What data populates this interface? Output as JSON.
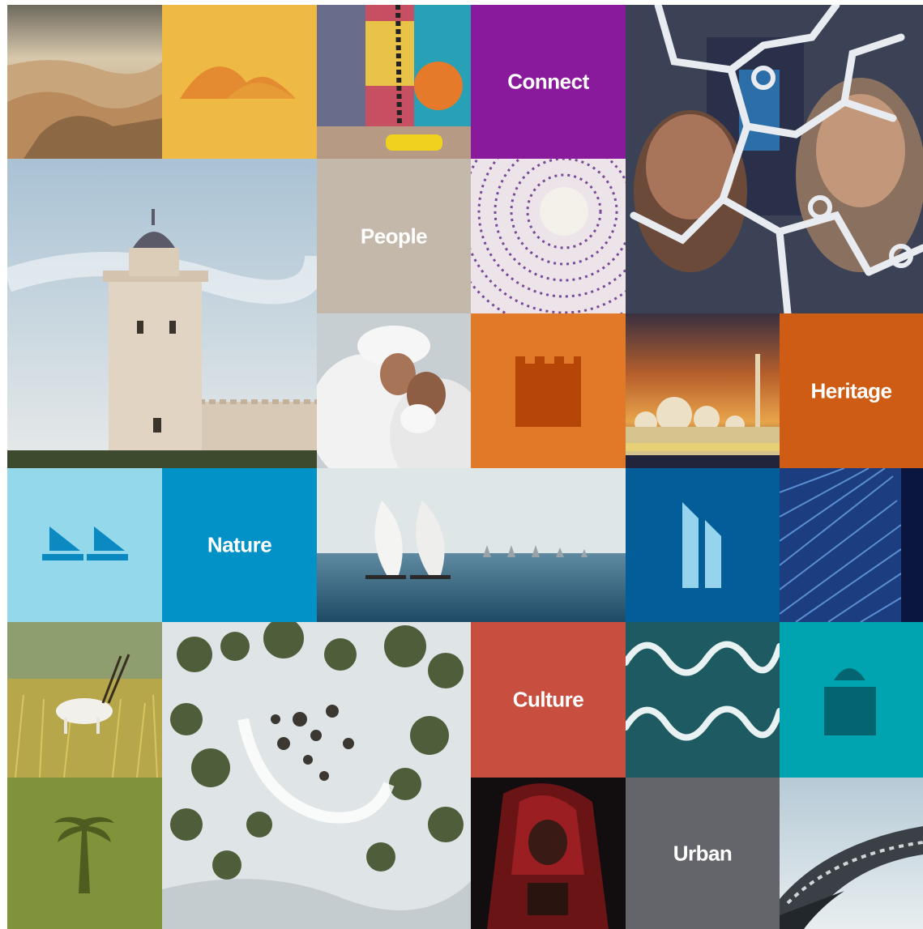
{
  "tiles": {
    "connect": {
      "label": "Connect",
      "color": "#8a1a9c"
    },
    "people": {
      "label": "People",
      "color": "#c4b8aa"
    },
    "heritage": {
      "label": "Heritage",
      "color": "#cf5c14"
    },
    "nature": {
      "label": "Nature",
      "color": "#0392c8"
    },
    "culture": {
      "label": "Culture",
      "color": "#c84e3f"
    },
    "urban": {
      "label": "Urban",
      "color": "#64656a"
    }
  },
  "icons": {
    "dunes": {
      "name": "sand-dunes-icon",
      "bg": "#efba44",
      "fg": "#e48a31"
    },
    "fort": {
      "name": "fort-tower-icon",
      "bg": "#e07a28",
      "fg": "#b64608"
    },
    "sailboats": {
      "name": "sailboats-icon",
      "bg": "#94d8ec",
      "fg": "#0b8ac2"
    },
    "towers": {
      "name": "skyscrapers-icon",
      "bg": "#035d98",
      "fg": "#96d3ec"
    },
    "dome": {
      "name": "dome-building-icon",
      "bg": "#00a3b0",
      "fg": "#046470"
    },
    "palm": {
      "name": "palm-tree-icon",
      "bg": "#80933a",
      "fg": "#4e5c1f"
    }
  },
  "photos": [
    "desert-dunes-photo",
    "playground-swing-photo",
    "people-digital-map-photo",
    "stone-watchtower-photo",
    "woven-pattern-photo",
    "elders-greeting-photo",
    "grand-mosque-sunset-photo",
    "sailing-dhows-photo",
    "glass-tower-photo",
    "oryx-grassland-photo",
    "aerial-mangroves-photo",
    "aerial-waves-photo",
    "red-veiled-figure-photo",
    "futuristic-building-photo"
  ]
}
